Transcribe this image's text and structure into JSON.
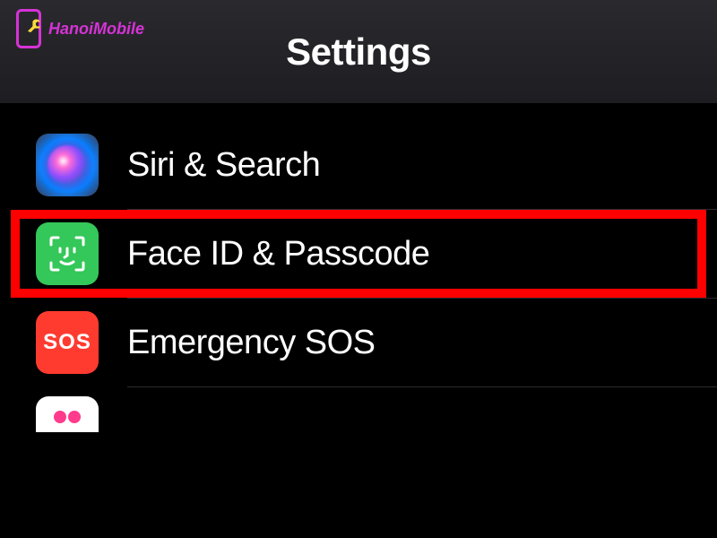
{
  "watermark": {
    "text": "HanoiMobile"
  },
  "header": {
    "title": "Settings"
  },
  "rows": [
    {
      "label": "Siri & Search",
      "icon": "siri",
      "highlighted": false
    },
    {
      "label": "Face ID & Passcode",
      "icon": "faceid",
      "highlighted": true
    },
    {
      "label": "Emergency SOS",
      "icon": "sos",
      "icon_text": "SOS",
      "highlighted": false
    }
  ],
  "colors": {
    "highlight": "#ff0000",
    "faceid_green": "#34c759",
    "sos_red": "#ff3b30",
    "watermark_magenta": "#d633d6"
  }
}
